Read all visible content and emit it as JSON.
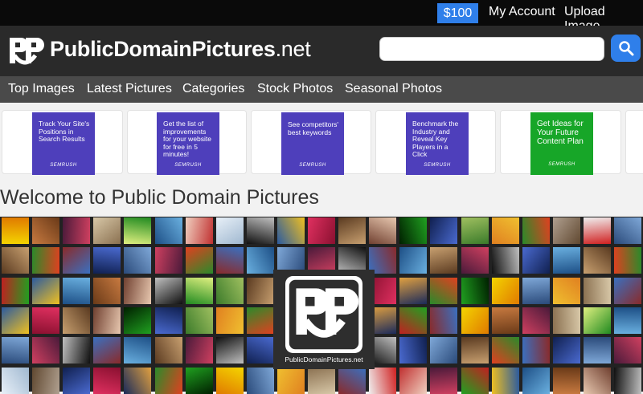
{
  "topbar": {
    "price_label": "$100",
    "account_label": "My Account",
    "upload_label": "Upload Image"
  },
  "header": {
    "logo_part1": "PublicDomain",
    "logo_part2": "Pictures",
    "logo_part3": ".net",
    "search_value": "",
    "search_placeholder": ""
  },
  "nav": {
    "items": [
      {
        "label": "Top Images"
      },
      {
        "label": "Latest Pictures"
      },
      {
        "label": "Categories"
      },
      {
        "label": "Stock Photos"
      },
      {
        "label": "Seasonal Photos"
      }
    ]
  },
  "ads": [
    {
      "text": "Track Your Site's Positions in Search Results",
      "brand": "SEMRUSH"
    },
    {
      "text": "Get the list of improvements for your website for free in 5 minutes!",
      "brand": "SEMRUSH"
    },
    {
      "text": "See competitors' best keywords",
      "brand": "SEMRUSH"
    },
    {
      "text": "Benchmark the Industry and Reveal Key Players in a Click",
      "brand": "SEMRUSH"
    },
    {
      "text": "Get Ideas for Your Future Content Plan",
      "brand": "SEMRUSH"
    }
  ],
  "welcome_title": "Welcome to Public Domain Pictures",
  "mosaic_logo_text": "PublicDomainPictures.net",
  "colors": {
    "accent": "#2f7fea",
    "topbar": "#0a0a0a",
    "header": "#2a2a2a",
    "nav": "#4a4a4a",
    "ad_purple": "#4e3fbb",
    "ad_green": "#17a628"
  }
}
